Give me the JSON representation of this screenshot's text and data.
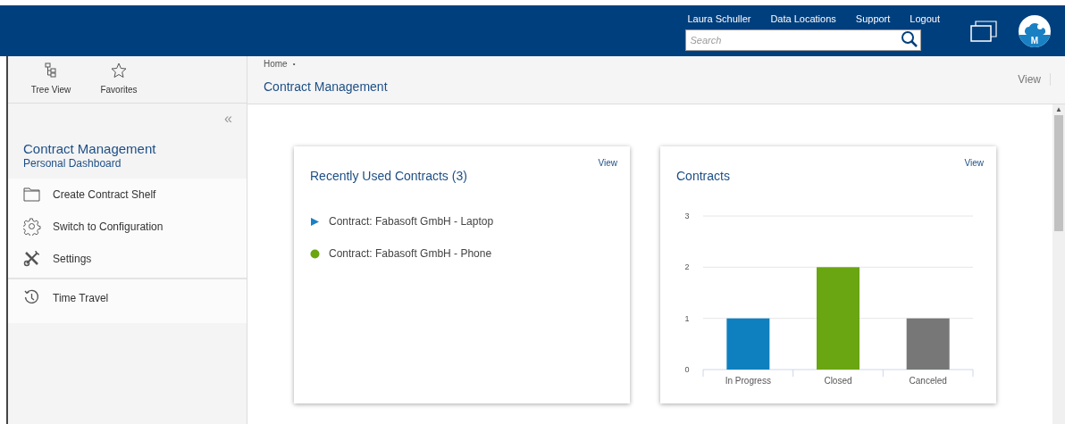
{
  "header": {
    "user_links": [
      {
        "label": "Laura Schuller"
      },
      {
        "label": "Data Locations"
      },
      {
        "label": "Support"
      },
      {
        "label": "Logout"
      }
    ],
    "search": {
      "placeholder": "Search"
    },
    "avatar": {
      "initial": "M"
    }
  },
  "sidebar": {
    "tools": [
      {
        "label": "Tree View",
        "kind": "tree"
      },
      {
        "label": "Favorites",
        "kind": "star"
      }
    ],
    "title": "Contract Management",
    "subtitle": "Personal Dashboard",
    "items": [
      {
        "label": "Create Contract Shelf",
        "kind": "folder"
      },
      {
        "label": "Switch to Configuration",
        "kind": "gear"
      },
      {
        "label": "Settings",
        "kind": "tools"
      },
      {
        "label": "Time Travel",
        "kind": "clock"
      }
    ]
  },
  "breadcrumb": [
    "Home"
  ],
  "page_title": "Contract Management",
  "view_menu": "View",
  "cards": [
    {
      "title": "Recently Used Contracts (3)",
      "action": "View",
      "contracts": [
        {
          "label": "Contract: Fabasoft GmbH - Laptop",
          "kind": "triangle",
          "color": "#1a80c4"
        },
        {
          "label": "Contract: Fabasoft GmbH - Phone",
          "kind": "circle",
          "color": "#6aa512"
        }
      ]
    },
    {
      "title": "Contracts",
      "action": "View",
      "chart_data": {
        "type": "bar",
        "categories": [
          "In Progress",
          "Closed",
          "Canceled"
        ],
        "stacked": true,
        "ylim": [
          0,
          3
        ],
        "yticks": [
          0,
          1,
          2,
          3
        ],
        "series": [
          {
            "color": "#0f80bf",
            "values": [
              1,
              null,
              null
            ]
          },
          {
            "color": "#6aa512",
            "values": [
              null,
              2,
              null
            ]
          },
          {
            "color": "#777777",
            "values": [
              null,
              null,
              1
            ]
          }
        ]
      }
    }
  ],
  "controls": {
    "collapse": "«",
    "breadcrumb_separator": "•",
    "scroll_up": "▲"
  }
}
